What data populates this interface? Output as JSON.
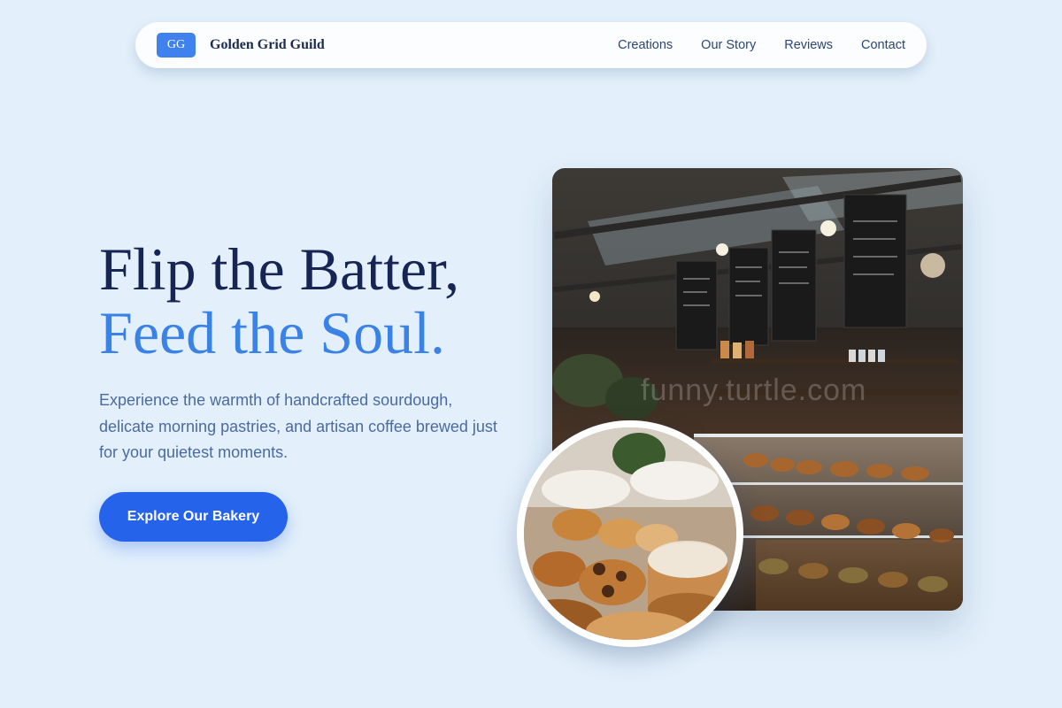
{
  "brand": {
    "badge": "GG",
    "name": "Golden Grid Guild"
  },
  "nav": {
    "links": [
      "Creations",
      "Our Story",
      "Reviews",
      "Contact"
    ]
  },
  "hero": {
    "title_line1": "Flip the Batter,",
    "title_line2": "Feed the Soul.",
    "subtitle": "Experience the warmth of handcrafted sourdough, delicate morning pastries, and artisan coffee brewed just for your quietest moments.",
    "cta_label": "Explore Our Bakery"
  },
  "images": {
    "main": {
      "icon": "bakery-interior-photo",
      "watermark": "funny.turtle.com"
    },
    "circle": {
      "icon": "pastries-photo"
    }
  },
  "colors": {
    "background": "#e3f0fb",
    "accent": "#2563eb",
    "title_dark": "#172554",
    "title_light": "#3b82e6"
  }
}
